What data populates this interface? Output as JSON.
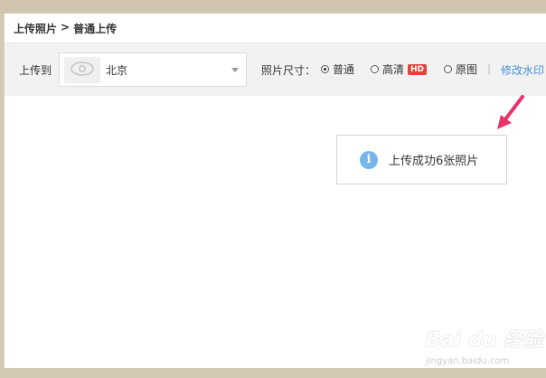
{
  "breadcrumb": {
    "root": "上传照片",
    "sep": ">",
    "current": "普通上传"
  },
  "toolbar": {
    "upload_to_label": "上传到",
    "album_name": "北京",
    "photo_size_label": "照片尺寸：",
    "options": [
      {
        "label": "普通",
        "checked": true
      },
      {
        "label": "高清",
        "badge": "HD",
        "checked": false
      },
      {
        "label": "原图",
        "checked": false
      }
    ],
    "separator": "|",
    "watermark_link": "修改水印"
  },
  "toast": {
    "message": "上传成功6张照片",
    "icon": "info-icon",
    "icon_glyph": "i"
  },
  "watermark": {
    "brand": "Bai du 经验",
    "url": "jingyan.baidu.com"
  },
  "colors": {
    "accent_link": "#4a8fd6",
    "hd_badge": "#e0453a",
    "info_icon": "#76b6ec",
    "arrow": "#e8336a"
  }
}
